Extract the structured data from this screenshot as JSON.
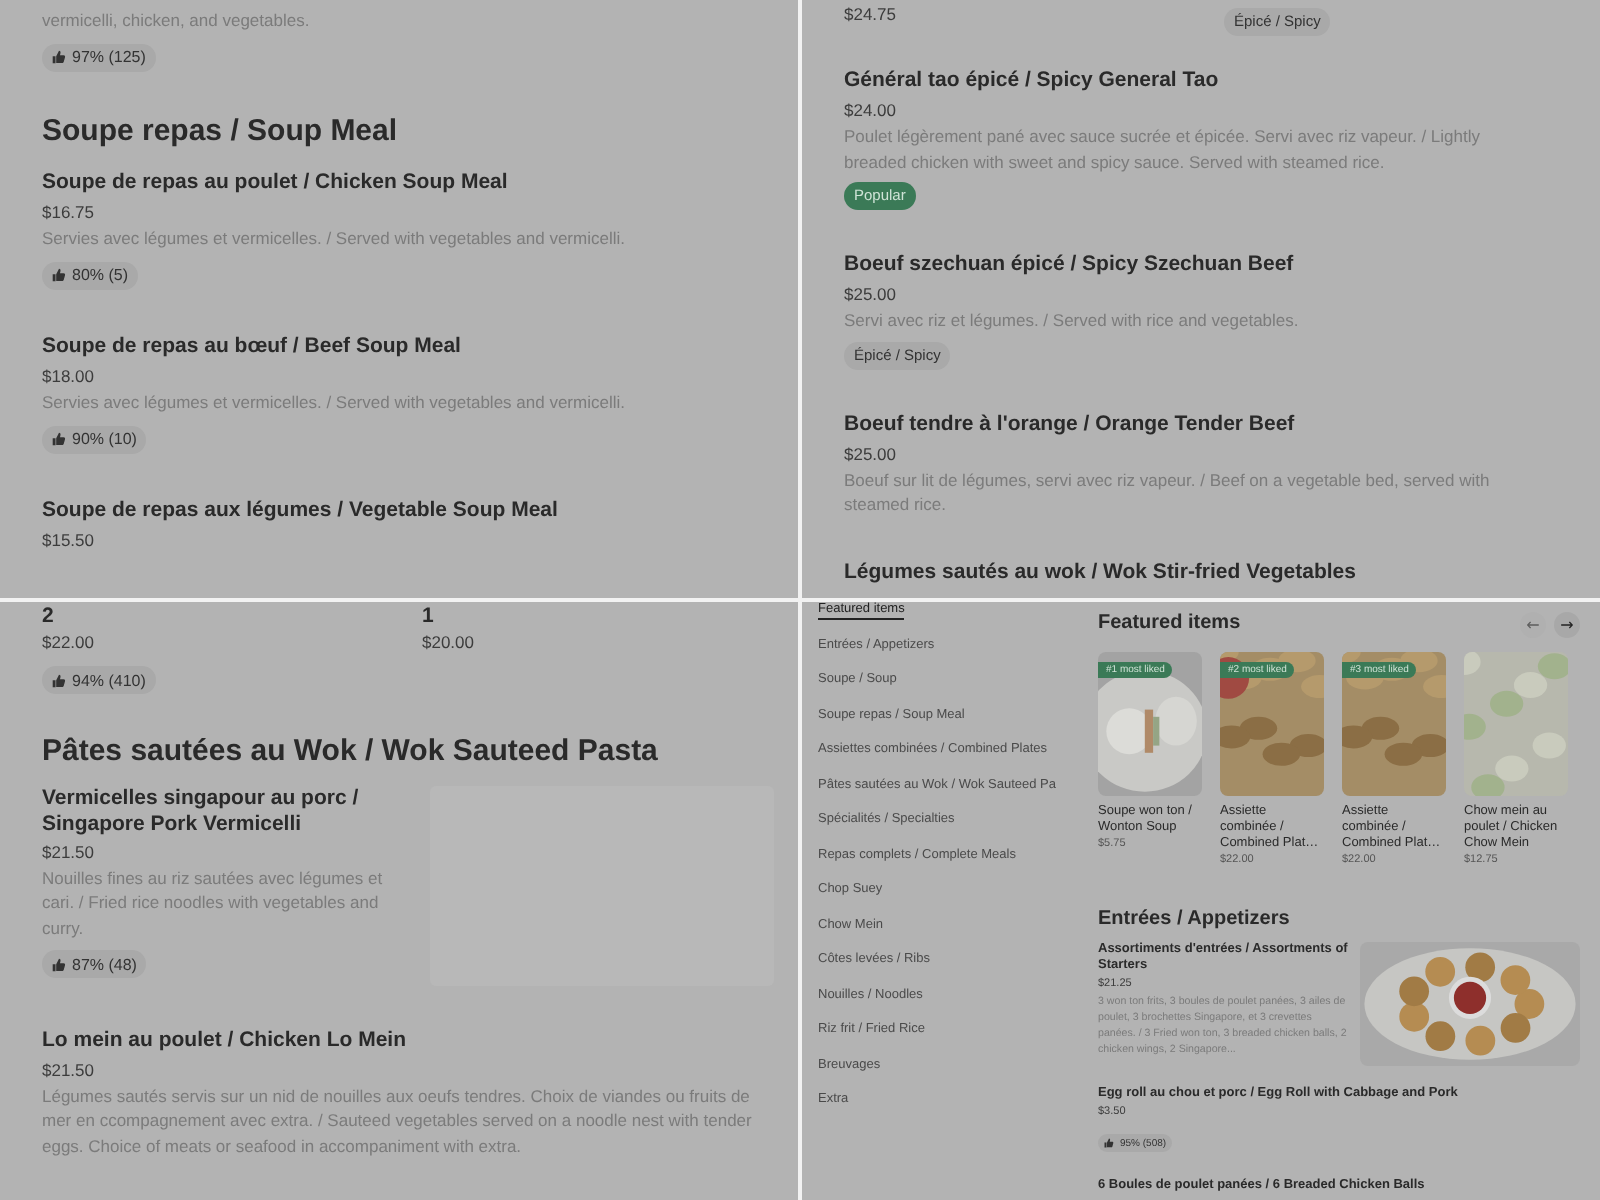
{
  "top_left": {
    "blocks": [
      {
        "kind": "fragment",
        "description": "vermicelli, chicken, and vegetables.",
        "rating": "97% (125)"
      },
      {
        "kind": "section",
        "title": "Soupe repas / Soup Meal"
      },
      {
        "kind": "item",
        "name": "Soupe de repas au poulet / Chicken Soup Meal",
        "price": "$16.75",
        "description": "Servies avec légumes et vermicelles. / Served with vegetables and vermicelli.",
        "rating": "80% (5)"
      },
      {
        "kind": "item",
        "name": "Soupe de repas au bœuf / Beef Soup Meal",
        "price": "$18.00",
        "description": "Servies avec légumes et vermicelles. / Served with vegetables and vermicelli.",
        "rating": "90% (10)"
      },
      {
        "kind": "item",
        "name": "Soupe de repas aux légumes / Vegetable Soup Meal",
        "price": "$15.50"
      }
    ]
  },
  "top_right": {
    "blocks": [
      {
        "kind": "pair",
        "columns": [
          {
            "price": "$24.75"
          },
          {
            "tag": {
              "label": "Épicé / Spicy",
              "kind": "plain"
            }
          }
        ]
      },
      {
        "kind": "item",
        "name": "Général tao épicé / Spicy General Tao",
        "price": "$24.00",
        "description": "Poulet légèrement pané avec sauce sucrée et épicée. Servi avec riz vapeur. / Lightly breaded chicken with sweet and spicy sauce. Served with steamed rice.",
        "tag": {
          "label": "Popular",
          "kind": "popular"
        }
      },
      {
        "kind": "item",
        "name": "Boeuf szechuan épicé / Spicy Szechuan Beef",
        "price": "$25.00",
        "description": "Servi avec riz et légumes. / Served with rice and vegetables.",
        "tag": {
          "label": "Épicé / Spicy",
          "kind": "plain"
        }
      },
      {
        "kind": "item",
        "name": "Boeuf tendre à l'orange / Orange Tender Beef",
        "price": "$25.00",
        "description": "Boeuf sur lit de légumes, servi avec riz vapeur. / Beef on a vegetable bed, served with steamed rice."
      },
      {
        "kind": "item",
        "name": "Légumes sautés au wok / Wok Stir-fried Vegetables"
      }
    ]
  },
  "bottom_left": {
    "blocks": [
      {
        "kind": "pair",
        "columns": [
          {
            "name": "2",
            "price": "$22.00",
            "rating": "94% (410)"
          },
          {
            "name": "1",
            "price": "$20.00"
          }
        ]
      },
      {
        "kind": "section",
        "title": "Pâtes sautées au Wok / Wok Sauteed Pasta"
      },
      {
        "kind": "item_image",
        "name": "Vermicelles singapour au porc / Singapore Pork Vermicelli",
        "price": "$21.50",
        "description": "Nouilles fines au riz sautées avec légumes et cari. / Fried rice noodles with vegetables and curry.",
        "rating": "87% (48)"
      },
      {
        "kind": "item",
        "name": "Lo mein au poulet / Chicken Lo Mein",
        "price": "$21.50",
        "description": "Légumes sautés servis sur un nid de nouilles aux oeufs tendres. Choix de viandes ou fruits de mer en ccompagnement avec extra. / Sauteed vegetables served on a noodle nest with tender eggs. Choice of meats or seafood in accompaniment with extra."
      }
    ]
  },
  "bottom_right": {
    "sidebar": [
      {
        "label": "Featured items",
        "selected": true
      },
      {
        "label": "Entrées / Appetizers",
        "selected": false
      },
      {
        "label": "Soupe / Soup",
        "selected": false
      },
      {
        "label": "Soupe repas / Soup Meal",
        "selected": false
      },
      {
        "label": "Assiettes combinées / Combined Plates",
        "selected": false
      },
      {
        "label": "Pâtes sautées au Wok / Wok Sauteed Pa",
        "selected": false
      },
      {
        "label": "Spécialités / Specialties",
        "selected": false
      },
      {
        "label": "Repas complets / Complete Meals",
        "selected": false
      },
      {
        "label": "Chop Suey",
        "selected": false
      },
      {
        "label": "Chow Mein",
        "selected": false
      },
      {
        "label": "Côtes levées / Ribs",
        "selected": false
      },
      {
        "label": "Nouilles / Noodles",
        "selected": false
      },
      {
        "label": "Riz frit / Fried Rice",
        "selected": false
      },
      {
        "label": "Breuvages",
        "selected": false
      },
      {
        "label": "Extra",
        "selected": false
      }
    ],
    "featured": {
      "title": "Featured items",
      "arrows": [
        {
          "label": "←",
          "disabled": true
        },
        {
          "label": "→",
          "disabled": false
        }
      ],
      "cards": [
        {
          "badge": "#1 most liked",
          "name": "Soupe won ton / Wonton Soup",
          "price": "$5.75"
        },
        {
          "badge": "#2 most liked",
          "name": "Assiette combinée / Combined Plat…",
          "price": "$22.00"
        },
        {
          "badge": "#3 most liked",
          "name": "Assiette combinée / Combined Plat…",
          "price": "$22.00"
        },
        {
          "name": "Chow mein au poulet / Chicken Chow Mein",
          "price": "$12.75"
        }
      ]
    },
    "section": {
      "title": "Entrées / Appetizers",
      "items": [
        {
          "kind": "item_image",
          "name": "Assortiments d'entrées / Assortments of Starters",
          "price": "$21.25",
          "description": "3 won ton frits, 3 boules de poulet panées, 3 ailes de poulet, 3 brochettes Singapore, et 3 crevettes panées. / 3 Fried won ton, 3 breaded chicken balls, 2 chicken wings, 2 Singapore..."
        },
        {
          "kind": "item",
          "name": "Egg roll au chou et porc / Egg Roll with Cabbage and Pork",
          "price": "$3.50",
          "rating": "95% (508)"
        },
        {
          "kind": "item",
          "name": "6 Boules de poulet panées / 6 Breaded Chicken Balls"
        }
      ]
    }
  }
}
